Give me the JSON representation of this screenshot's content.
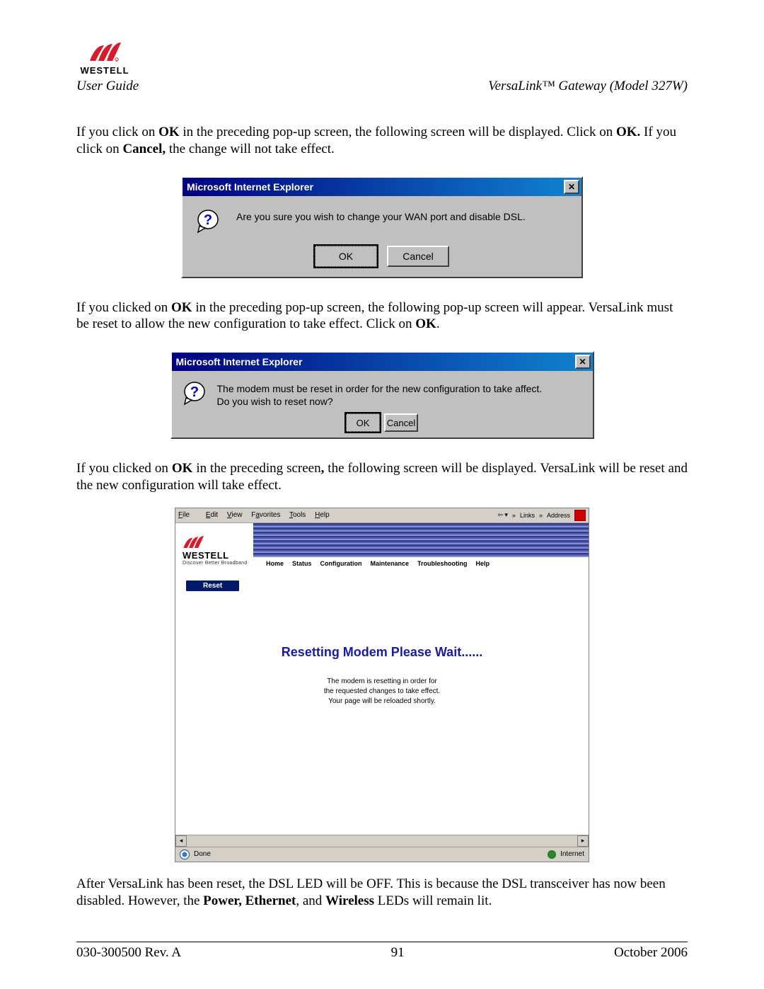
{
  "header": {
    "logo_text": "WESTELL",
    "left": "User Guide",
    "right": "VersaLink™  Gateway (Model 327W)"
  },
  "para1": {
    "a": "If you click on ",
    "b": "OK",
    "c": " in the preceding pop-up screen, the following screen will be displayed. Click on ",
    "d": "OK.",
    "e": " If you click on ",
    "f": "Cancel,",
    "g": " the change will not take effect."
  },
  "dialog1": {
    "title": "Microsoft Internet Explorer",
    "message": "Are you sure you wish to change your WAN port and disable DSL.",
    "ok": "OK",
    "cancel": "Cancel"
  },
  "para2": {
    "a": "If you clicked on ",
    "b": "OK",
    "c": " in the preceding pop-up screen, the following pop-up screen will appear. VersaLink must be reset to allow the new configuration to take effect. Click on ",
    "d": "OK",
    "e": "."
  },
  "dialog2": {
    "title": "Microsoft Internet Explorer",
    "message": "The modem must be reset in order for the new configuration to take affect.\nDo you wish to reset now?",
    "ok": "OK",
    "cancel": "Cancel"
  },
  "para3": {
    "a": "If you clicked on ",
    "b": "OK",
    "c": " in the preceding screen",
    "d": ",",
    "e": " the following screen will be displayed. VersaLink will be reset and the new configuration will take effect."
  },
  "browser": {
    "menu": {
      "file": "File",
      "edit": "Edit",
      "view": "View",
      "favorites": "Favorites",
      "tools": "Tools",
      "help": "Help"
    },
    "toolbar": {
      "links": "Links",
      "address": "Address"
    },
    "banner": {
      "logo_text": "WESTELL",
      "tagline": "Discover Better Broadband",
      "nav": [
        "Home",
        "Status",
        "Configuration",
        "Maintenance",
        "Troubleshooting",
        "Help"
      ]
    },
    "sidebar_tag": "Reset",
    "reset_title": "Resetting Modem Please Wait......",
    "reset_body": "The modem is resetting in order for\nthe requested changes to take effect.\nYour page will be reloaded shortly.",
    "status_done": "Done",
    "status_zone": "Internet"
  },
  "para4": {
    "a": "After VersaLink has been reset, the DSL LED will be OFF. This is because the DSL transceiver has now been disabled. However, the ",
    "b": "Power, Ethernet",
    "c": ", and ",
    "d": "Wireless",
    "e": " LEDs will remain lit."
  },
  "footer": {
    "left": "030-300500 Rev. A",
    "center": "91",
    "right": "October 2006"
  }
}
